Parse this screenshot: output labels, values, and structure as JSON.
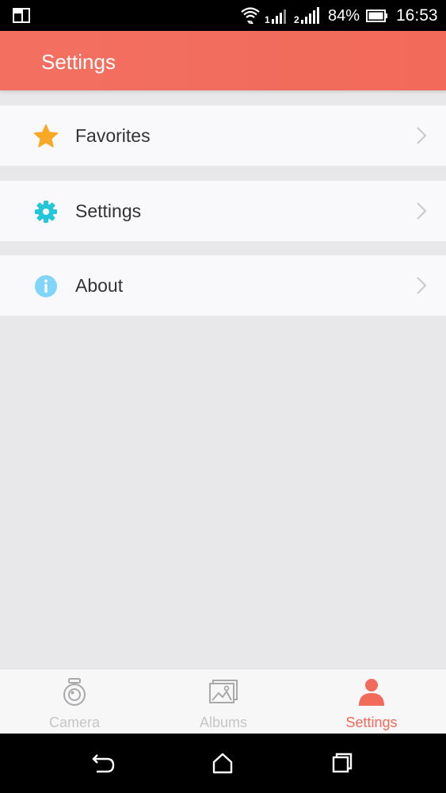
{
  "status_bar": {
    "battery": "84%",
    "time": "16:53"
  },
  "app_bar": {
    "title": "Settings"
  },
  "menu": {
    "items": [
      {
        "label": "Favorites",
        "icon": "star-icon",
        "icon_color": "#f9a825"
      },
      {
        "label": "Settings",
        "icon": "gear-icon",
        "icon_color": "#26c6da"
      },
      {
        "label": "About",
        "icon": "info-icon",
        "icon_color": "#81d4fa"
      }
    ]
  },
  "bottom_nav": {
    "tabs": [
      {
        "label": "Camera",
        "icon": "camera-icon"
      },
      {
        "label": "Albums",
        "icon": "albums-icon"
      },
      {
        "label": "Settings",
        "icon": "person-icon",
        "active": true
      }
    ]
  },
  "colors": {
    "accent": "#f26a5a",
    "background": "#e8e7ea",
    "row_background": "#f9f8fa",
    "inactive_tab": "#c6c6c8"
  }
}
